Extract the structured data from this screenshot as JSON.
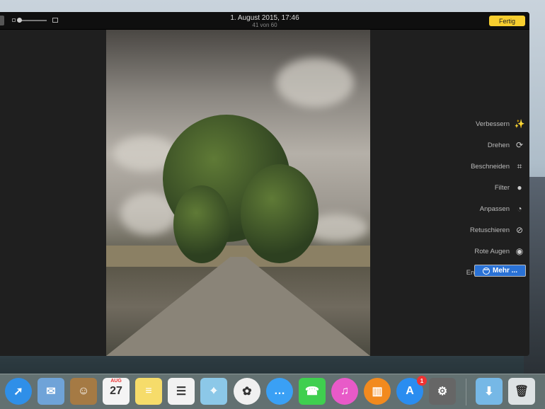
{
  "window": {
    "title": "1. August 2015, 17:46",
    "subtitle": "41 von 60",
    "done_label": "Fertig"
  },
  "tools": [
    {
      "label": "Verbessern",
      "icon": "magic-wand-icon",
      "glyph": "✨"
    },
    {
      "label": "Drehen",
      "icon": "rotate-icon",
      "glyph": "⟳"
    },
    {
      "label": "Beschneiden",
      "icon": "crop-icon",
      "glyph": "⌗"
    },
    {
      "label": "Filter",
      "icon": "filter-icon",
      "glyph": "●"
    },
    {
      "label": "Anpassen",
      "icon": "adjust-icon",
      "glyph": "◔"
    },
    {
      "label": "Retuschieren",
      "icon": "bandage-icon",
      "glyph": "⊘"
    },
    {
      "label": "Rote Augen",
      "icon": "eye-icon",
      "glyph": "◉"
    },
    {
      "label": "Erweiterungen",
      "icon": "more-icon",
      "glyph": "⋯"
    }
  ],
  "more_button": {
    "label": "Mehr ..."
  },
  "dock": [
    {
      "name": "safari",
      "glyph": "➚",
      "color": "#2f8fe8"
    },
    {
      "name": "mail",
      "glyph": "✉",
      "color": "#6fa3d8"
    },
    {
      "name": "contacts",
      "glyph": "☺",
      "color": "#a57a44"
    },
    {
      "name": "calendar",
      "glyph": "27",
      "month": "AUG",
      "color": "#f4f4f4"
    },
    {
      "name": "notes",
      "glyph": "≡",
      "color": "#f6dc6a"
    },
    {
      "name": "reminders",
      "glyph": "☰",
      "color": "#f2f2f2"
    },
    {
      "name": "maps",
      "glyph": "⌖",
      "color": "#8cc8e8"
    },
    {
      "name": "photos",
      "glyph": "✿",
      "color": "#f0f0f0"
    },
    {
      "name": "messages",
      "glyph": "…",
      "color": "#3aa0f5"
    },
    {
      "name": "facetime",
      "glyph": "☎",
      "color": "#3fcf4f"
    },
    {
      "name": "itunes",
      "glyph": "♫",
      "color": "#e85ac8"
    },
    {
      "name": "ibooks",
      "glyph": "▥",
      "color": "#f28a1e"
    },
    {
      "name": "app-store",
      "glyph": "A",
      "color": "#2a8df0",
      "badge": "1"
    },
    {
      "name": "system-preferences",
      "glyph": "⚙",
      "color": "#666"
    },
    {
      "name": "downloads",
      "glyph": "⬇",
      "color": "#76b8e6"
    },
    {
      "name": "trash",
      "glyph": "🗑",
      "color": "#dde2e4"
    }
  ]
}
